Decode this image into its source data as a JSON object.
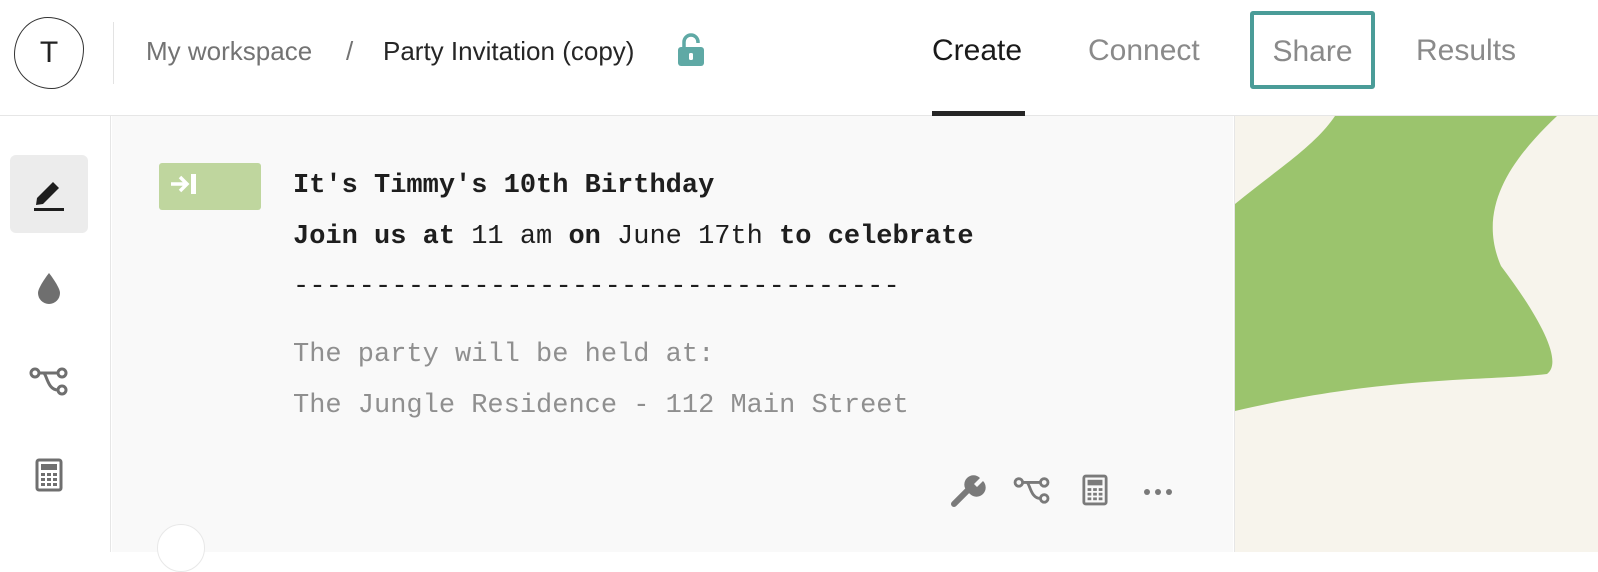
{
  "header": {
    "logo_letter": "T",
    "breadcrumb_workspace": "My workspace",
    "breadcrumb_separator": "/",
    "form_title": "Party Invitation (copy)",
    "lock_icon": "lock-icon",
    "tabs": [
      {
        "label": "Create",
        "active": true
      },
      {
        "label": "Connect",
        "active": false
      },
      {
        "label": "Share",
        "active": false,
        "highlighted": true
      },
      {
        "label": "Results",
        "active": false
      }
    ]
  },
  "sidebar": {
    "items": [
      {
        "icon": "pencil-icon",
        "active": true
      },
      {
        "icon": "droplet-icon",
        "active": false
      },
      {
        "icon": "logic-branch-icon",
        "active": false
      },
      {
        "icon": "calculator-icon",
        "active": false
      }
    ]
  },
  "block": {
    "badge_icon": "arrow-into-bar-icon",
    "title": "It's Timmy's 10th Birthday",
    "line2": {
      "part1": "Join us at",
      "time": " 11 am ",
      "part2": "on",
      "date": " June 17th ",
      "part3": "to celebrate"
    },
    "divider": "-------------------------------------",
    "venue_label": "The party will be held at:",
    "venue_address": "The Jungle Residence - 112 Main Street",
    "tools": [
      "wrench-icon",
      "logic-branch-icon",
      "calculator-icon",
      "more-icon"
    ]
  },
  "colors": {
    "accent": "#4a9c98",
    "lock": "#5fa9a5",
    "badge": "#bfd69e",
    "preview_bg": "#f7f4ec",
    "preview_blob": "#9bc46d"
  }
}
